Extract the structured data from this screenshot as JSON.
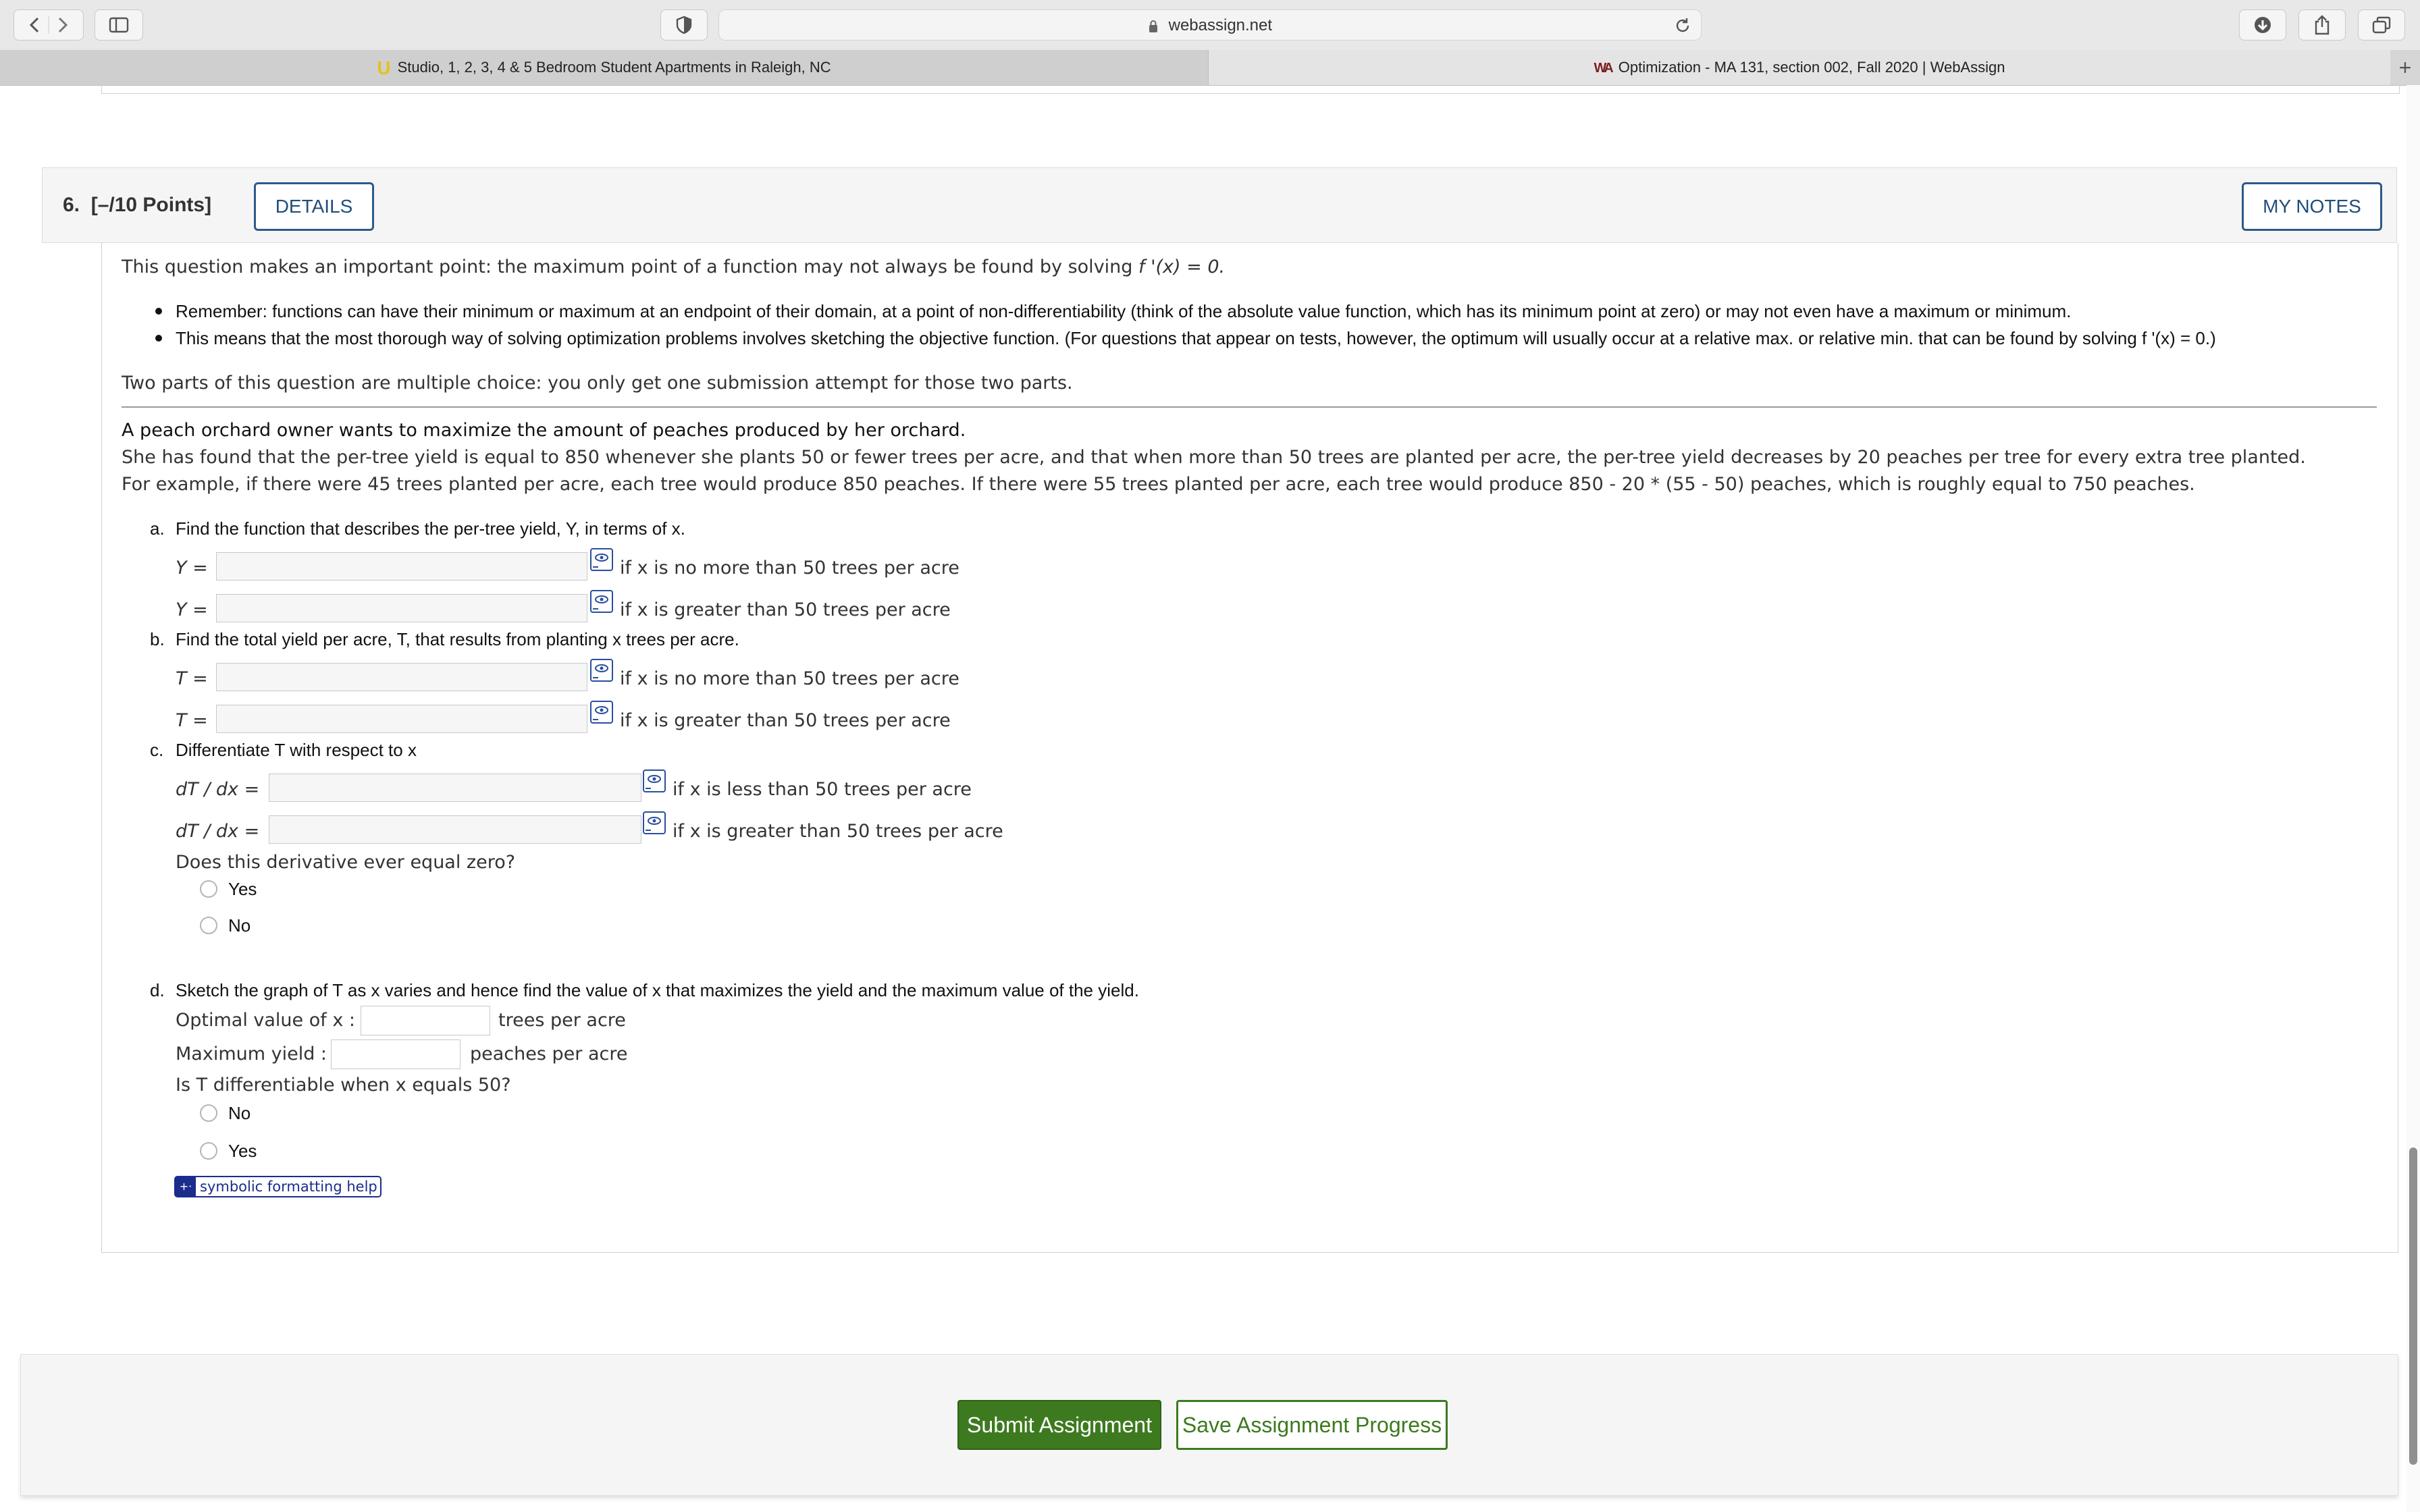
{
  "browser": {
    "url": "webassign.net",
    "tabs": [
      {
        "favicon": "U",
        "title": "Studio, 1, 2, 3, 4 & 5 Bedroom Student Apartments in Raleigh, NC"
      },
      {
        "favicon": "WA",
        "title": "Optimization - MA 131, section 002, Fall 2020 | WebAssign"
      }
    ],
    "new_tab": "+"
  },
  "question": {
    "number": "6.",
    "points": "[–/10 Points]",
    "details_label": "DETAILS",
    "notes_label": "MY NOTES",
    "intro_pre": "This question makes an important point: the maximum point of a function may not always be found by solving ",
    "intro_math": "f '(x) = 0.",
    "bullets": [
      "Remember: functions can have their minimum or maximum at an endpoint of their domain, at a point of non-differentiability (think of the absolute value function, which has its minimum point at zero) or may not even have a maximum or minimum.",
      "This means that the most thorough way of solving optimization problems involves sketching the objective function. (For questions that appear on tests, however, the optimum will usually occur at a relative max. or relative min. that can be found by solving f '(x) = 0.)"
    ],
    "multiple_choice_note": "Two parts of this question are multiple choice: you only get one submission attempt for those two parts.",
    "problem": [
      "A peach orchard owner wants to maximize the amount of peaches produced by her orchard.",
      "She has found that the per-tree yield is equal to 850 whenever she plants 50 or fewer trees per acre, and that when more than 50 trees are planted per acre, the per-tree yield decreases by 20 peaches per tree for every extra tree planted.",
      "For example, if there were 45 trees planted per acre, each tree would produce 850 peaches. If there were 55 trees planted per acre, each tree would produce 850 - 20 * (55 - 50) peaches, which is roughly equal to 750 peaches."
    ],
    "part_a": {
      "label": "a.",
      "prompt": "Find the function that describes the per-tree yield, Y, in terms of x.",
      "rows": [
        {
          "lhs": "Y =",
          "cond": "if x is no more than 50 trees per acre",
          "value": ""
        },
        {
          "lhs": "Y =",
          "cond": "if x is greater than 50 trees per acre",
          "value": ""
        }
      ]
    },
    "part_b": {
      "label": "b.",
      "prompt": "Find the total yield per acre, T, that results from planting x trees per acre.",
      "rows": [
        {
          "lhs": "T =",
          "cond": "if x is no more than 50 trees per acre",
          "value": ""
        },
        {
          "lhs": "T =",
          "cond": "if x is greater than 50 trees per acre",
          "value": ""
        }
      ]
    },
    "part_c": {
      "label": "c.",
      "prompt": "Differentiate T with respect to x",
      "rows": [
        {
          "lhs": "dT / dx =",
          "cond": "if x is less than 50 trees per acre",
          "value": ""
        },
        {
          "lhs": "dT / dx =",
          "cond": "if x is greater than 50 trees per acre",
          "value": ""
        }
      ],
      "question": "Does this derivative ever equal zero?",
      "options": [
        "Yes",
        "No"
      ]
    },
    "part_d": {
      "label": "d.",
      "prompt": "Sketch the graph of T as x varies and hence find the value of x that maximizes the yield and the maximum value of the yield.",
      "optimal_label": "Optimal value of x :",
      "optimal_unit": "trees per acre",
      "optimal_value": "",
      "max_label": "Maximum yield :",
      "max_unit": "peaches per acre",
      "max_value": "",
      "question": "Is T differentiable when x equals 50?",
      "options": [
        "No",
        "Yes"
      ]
    },
    "help_label": "symbolic formatting help"
  },
  "footer": {
    "submit_label": "Submit Assignment",
    "save_label": "Save Assignment Progress"
  }
}
